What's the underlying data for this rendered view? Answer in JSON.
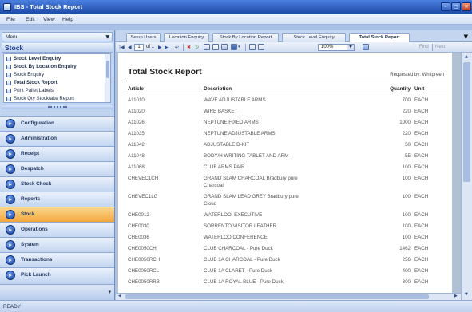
{
  "window": {
    "title": "IBS - Total Stock Report"
  },
  "menu_bar": {
    "items": [
      {
        "label": "File"
      },
      {
        "label": "Edit"
      },
      {
        "label": "View"
      },
      {
        "label": "Help"
      }
    ]
  },
  "navigation": {
    "header_label": "Menu",
    "section_title": "Stock",
    "tree_items": [
      {
        "label": "Stock Level Enquiry",
        "icon": "report-icon"
      },
      {
        "label": "Stock By Location Enquiry",
        "icon": "report-icon"
      },
      {
        "label": "Stock Enquiry",
        "icon": "report-icon"
      },
      {
        "label": "Total Stock Report",
        "icon": "report-icon"
      },
      {
        "label": "Print Pallet Labels",
        "icon": "report-icon"
      },
      {
        "label": "Stock Qty Stocktake Report",
        "icon": "report-icon"
      }
    ],
    "modules": [
      {
        "label": "Configuration",
        "icon": "configuration-icon"
      },
      {
        "label": "Administration",
        "icon": "administration-icon"
      },
      {
        "label": "Receipt",
        "icon": "receipt-icon"
      },
      {
        "label": "Despatch",
        "icon": "despatch-icon"
      },
      {
        "label": "Stock Check",
        "icon": "stock-check-icon"
      },
      {
        "label": "Reports",
        "icon": "reports-icon"
      },
      {
        "label": "Stock",
        "icon": "stock-icon"
      },
      {
        "label": "Operations",
        "icon": "operations-icon"
      },
      {
        "label": "System",
        "icon": "system-icon"
      },
      {
        "label": "Transactions",
        "icon": "transactions-icon"
      },
      {
        "label": "Pick Launch",
        "icon": "pick-launch-icon"
      }
    ]
  },
  "tabs": [
    {
      "label": "Setup Users"
    },
    {
      "label": "Location Enquiry"
    },
    {
      "label": "Stock By Location Report"
    },
    {
      "label": "Stock Level Enquiry"
    },
    {
      "label": "Total Stock Report"
    }
  ],
  "toolbar": {
    "page_number": "1",
    "page_count": "of 1",
    "zoom": "100%",
    "find_label": "Find",
    "next_label": "Next"
  },
  "report": {
    "title": "Total Stock Report",
    "requested_by": "Requested by: Whitgreen",
    "columns": {
      "article": "Article",
      "description": "Description",
      "quantity": "Quantity",
      "unit": "Unit"
    },
    "rows": [
      {
        "article": "A11010",
        "description": "WAVE ADJUSTABLE ARMS",
        "quantity": "700",
        "unit": "EACH"
      },
      {
        "article": "A11020",
        "description": "WIRE BASKET",
        "quantity": "220",
        "unit": "EACH"
      },
      {
        "article": "A11026",
        "description": "NEPTUNE FIXED ARMS",
        "quantity": "1000",
        "unit": "EACH"
      },
      {
        "article": "A11035",
        "description": "NEPTUNE ADJUSTABLE ARMS",
        "quantity": "220",
        "unit": "EACH"
      },
      {
        "article": "A11042",
        "description": "ADJUSTABLE D-KIT",
        "quantity": "50",
        "unit": "EACH"
      },
      {
        "article": "A11048",
        "description": "BODY/H WRITING TABLET AND ARM",
        "quantity": "55",
        "unit": "EACH"
      },
      {
        "article": "A11068",
        "description": "CLUB ARMS PAIR",
        "quantity": "100",
        "unit": "EACH"
      },
      {
        "article": "CHEVEC1CH",
        "description": "GRAND SLAM CHARCOAL Bradbury pure Charcoal",
        "quantity": "100",
        "unit": "EACH"
      },
      {
        "article": "CHEVEC1LG",
        "description": "GRAND SLAM LEAD GREY Bradbury pure Cloud",
        "quantity": "100",
        "unit": "EACH"
      },
      {
        "article": "CHE0012",
        "description": "WATERLOO, EXECUTIVE",
        "quantity": "100",
        "unit": "EACH"
      },
      {
        "article": "CHE0030",
        "description": "SORRENTO VISITOR LEATHER",
        "quantity": "100",
        "unit": "EACH"
      },
      {
        "article": "CHE0036",
        "description": "WATERLOO CONFERENCE",
        "quantity": "100",
        "unit": "EACH"
      },
      {
        "article": "CHE0050CH",
        "description": "CLUB CHARCOAL - Pure Duck",
        "quantity": "1462",
        "unit": "EACH"
      },
      {
        "article": "CHE0050RCH",
        "description": "CLUB 1A CHARCOAL - Pure Duck",
        "quantity": "256",
        "unit": "EACH"
      },
      {
        "article": "CHE0050RCL",
        "description": "CLUB 1A CLARET - Pure Duck",
        "quantity": "400",
        "unit": "EACH"
      },
      {
        "article": "CHE0050RRB",
        "description": "CLUB 1A ROYAL BLUE - Pure Duck",
        "quantity": "300",
        "unit": "EACH"
      }
    ]
  },
  "status_bar": {
    "text": "READY"
  },
  "colors": {
    "title_bar": "#1c48a6",
    "active_module": "#f2a73a",
    "panel": "#c0d3ef",
    "report_text": "#555555"
  }
}
